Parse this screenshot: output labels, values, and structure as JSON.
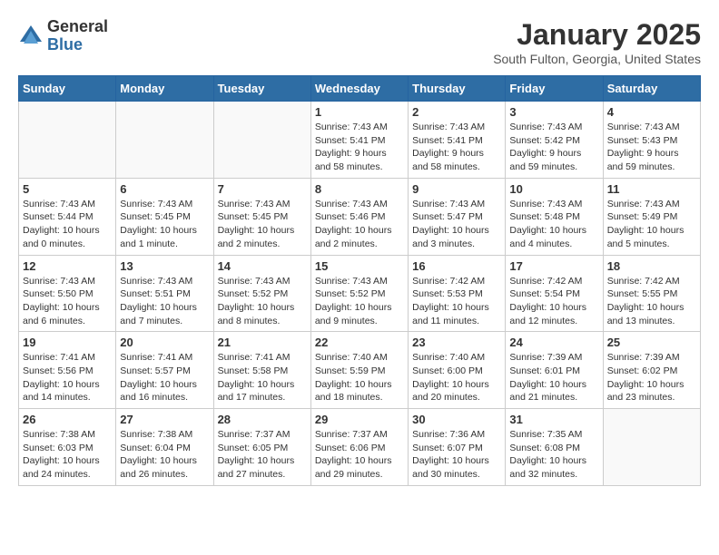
{
  "header": {
    "logo_general": "General",
    "logo_blue": "Blue",
    "month_title": "January 2025",
    "location": "South Fulton, Georgia, United States"
  },
  "weekdays": [
    "Sunday",
    "Monday",
    "Tuesday",
    "Wednesday",
    "Thursday",
    "Friday",
    "Saturday"
  ],
  "weeks": [
    [
      {
        "day": "",
        "info": ""
      },
      {
        "day": "",
        "info": ""
      },
      {
        "day": "",
        "info": ""
      },
      {
        "day": "1",
        "info": "Sunrise: 7:43 AM\nSunset: 5:41 PM\nDaylight: 9 hours\nand 58 minutes."
      },
      {
        "day": "2",
        "info": "Sunrise: 7:43 AM\nSunset: 5:41 PM\nDaylight: 9 hours\nand 58 minutes."
      },
      {
        "day": "3",
        "info": "Sunrise: 7:43 AM\nSunset: 5:42 PM\nDaylight: 9 hours\nand 59 minutes."
      },
      {
        "day": "4",
        "info": "Sunrise: 7:43 AM\nSunset: 5:43 PM\nDaylight: 9 hours\nand 59 minutes."
      }
    ],
    [
      {
        "day": "5",
        "info": "Sunrise: 7:43 AM\nSunset: 5:44 PM\nDaylight: 10 hours\nand 0 minutes."
      },
      {
        "day": "6",
        "info": "Sunrise: 7:43 AM\nSunset: 5:45 PM\nDaylight: 10 hours\nand 1 minute."
      },
      {
        "day": "7",
        "info": "Sunrise: 7:43 AM\nSunset: 5:45 PM\nDaylight: 10 hours\nand 2 minutes."
      },
      {
        "day": "8",
        "info": "Sunrise: 7:43 AM\nSunset: 5:46 PM\nDaylight: 10 hours\nand 2 minutes."
      },
      {
        "day": "9",
        "info": "Sunrise: 7:43 AM\nSunset: 5:47 PM\nDaylight: 10 hours\nand 3 minutes."
      },
      {
        "day": "10",
        "info": "Sunrise: 7:43 AM\nSunset: 5:48 PM\nDaylight: 10 hours\nand 4 minutes."
      },
      {
        "day": "11",
        "info": "Sunrise: 7:43 AM\nSunset: 5:49 PM\nDaylight: 10 hours\nand 5 minutes."
      }
    ],
    [
      {
        "day": "12",
        "info": "Sunrise: 7:43 AM\nSunset: 5:50 PM\nDaylight: 10 hours\nand 6 minutes."
      },
      {
        "day": "13",
        "info": "Sunrise: 7:43 AM\nSunset: 5:51 PM\nDaylight: 10 hours\nand 7 minutes."
      },
      {
        "day": "14",
        "info": "Sunrise: 7:43 AM\nSunset: 5:52 PM\nDaylight: 10 hours\nand 8 minutes."
      },
      {
        "day": "15",
        "info": "Sunrise: 7:43 AM\nSunset: 5:52 PM\nDaylight: 10 hours\nand 9 minutes."
      },
      {
        "day": "16",
        "info": "Sunrise: 7:42 AM\nSunset: 5:53 PM\nDaylight: 10 hours\nand 11 minutes."
      },
      {
        "day": "17",
        "info": "Sunrise: 7:42 AM\nSunset: 5:54 PM\nDaylight: 10 hours\nand 12 minutes."
      },
      {
        "day": "18",
        "info": "Sunrise: 7:42 AM\nSunset: 5:55 PM\nDaylight: 10 hours\nand 13 minutes."
      }
    ],
    [
      {
        "day": "19",
        "info": "Sunrise: 7:41 AM\nSunset: 5:56 PM\nDaylight: 10 hours\nand 14 minutes."
      },
      {
        "day": "20",
        "info": "Sunrise: 7:41 AM\nSunset: 5:57 PM\nDaylight: 10 hours\nand 16 minutes."
      },
      {
        "day": "21",
        "info": "Sunrise: 7:41 AM\nSunset: 5:58 PM\nDaylight: 10 hours\nand 17 minutes."
      },
      {
        "day": "22",
        "info": "Sunrise: 7:40 AM\nSunset: 5:59 PM\nDaylight: 10 hours\nand 18 minutes."
      },
      {
        "day": "23",
        "info": "Sunrise: 7:40 AM\nSunset: 6:00 PM\nDaylight: 10 hours\nand 20 minutes."
      },
      {
        "day": "24",
        "info": "Sunrise: 7:39 AM\nSunset: 6:01 PM\nDaylight: 10 hours\nand 21 minutes."
      },
      {
        "day": "25",
        "info": "Sunrise: 7:39 AM\nSunset: 6:02 PM\nDaylight: 10 hours\nand 23 minutes."
      }
    ],
    [
      {
        "day": "26",
        "info": "Sunrise: 7:38 AM\nSunset: 6:03 PM\nDaylight: 10 hours\nand 24 minutes."
      },
      {
        "day": "27",
        "info": "Sunrise: 7:38 AM\nSunset: 6:04 PM\nDaylight: 10 hours\nand 26 minutes."
      },
      {
        "day": "28",
        "info": "Sunrise: 7:37 AM\nSunset: 6:05 PM\nDaylight: 10 hours\nand 27 minutes."
      },
      {
        "day": "29",
        "info": "Sunrise: 7:37 AM\nSunset: 6:06 PM\nDaylight: 10 hours\nand 29 minutes."
      },
      {
        "day": "30",
        "info": "Sunrise: 7:36 AM\nSunset: 6:07 PM\nDaylight: 10 hours\nand 30 minutes."
      },
      {
        "day": "31",
        "info": "Sunrise: 7:35 AM\nSunset: 6:08 PM\nDaylight: 10 hours\nand 32 minutes."
      },
      {
        "day": "",
        "info": ""
      }
    ]
  ]
}
